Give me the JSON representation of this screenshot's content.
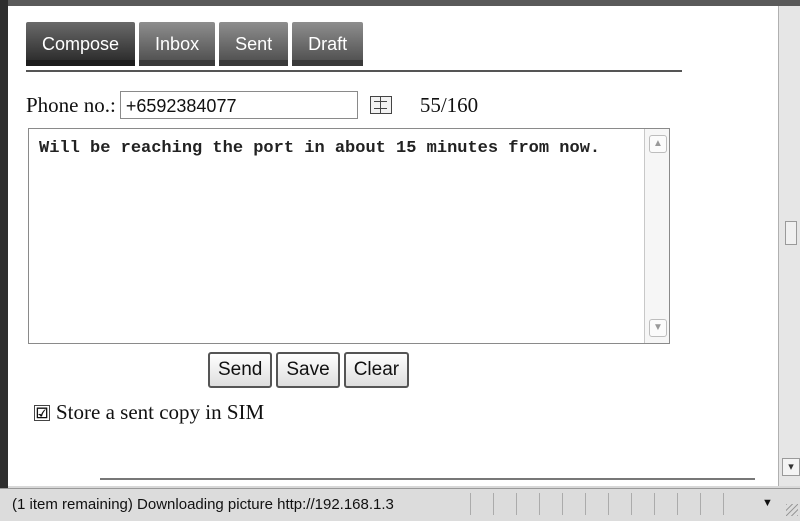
{
  "tabs": [
    {
      "label": "Compose",
      "active": true
    },
    {
      "label": "Inbox",
      "active": false
    },
    {
      "label": "Sent",
      "active": false
    },
    {
      "label": "Draft",
      "active": false
    }
  ],
  "compose": {
    "phone_label": "Phone no.:",
    "phone_value": "+6592384077",
    "phonebook_icon": "phonebook-icon",
    "char_count": "55/160",
    "message_text": "Will be reaching the port in about 15 minutes from now.",
    "buttons": {
      "send": "Send",
      "save": "Save",
      "clear": "Clear"
    },
    "store_copy": {
      "label": "Store a sent copy in SIM",
      "checked": true,
      "check_glyph": "☑"
    }
  },
  "status_bar": {
    "text": "(1 item remaining) Downloading picture http://192.168.1.3"
  }
}
